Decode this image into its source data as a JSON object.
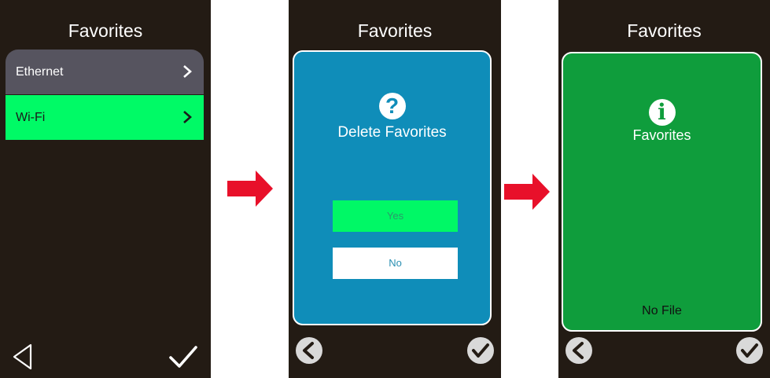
{
  "screens": [
    {
      "title": "Favorites",
      "items": [
        {
          "label": "Ethernet"
        },
        {
          "label": "Wi-Fi"
        }
      ]
    },
    {
      "title": "Favorites",
      "dialog": {
        "icon": "question-icon",
        "icon_glyph": "?",
        "message": "Delete Favorites",
        "yes_label": "Yes",
        "no_label": "No"
      }
    },
    {
      "title": "Favorites",
      "dialog": {
        "icon": "info-icon",
        "icon_glyph": "i",
        "message": "Favorites",
        "status": "No File"
      }
    }
  ],
  "colors": {
    "screen_bg": "#231b14",
    "selected_row": "#00fa66",
    "ethernet_row": "#56545f",
    "dialog_blue": "#0f8db9",
    "dialog_green": "#0f9d3c",
    "arrow_red": "#e8102a"
  }
}
